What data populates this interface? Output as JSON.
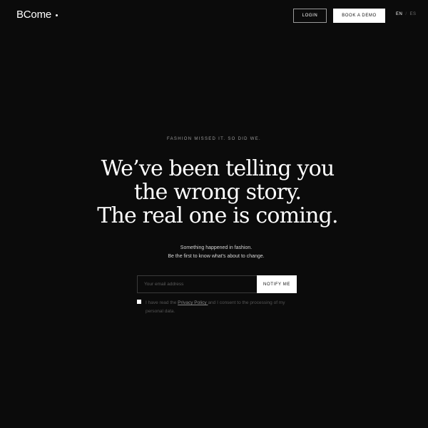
{
  "header": {
    "logo_text": "BCome",
    "login_label": "LOGIN",
    "demo_label": "BOOK A DEMO",
    "lang": {
      "active": "EN",
      "separator": "/",
      "inactive": "ES"
    }
  },
  "hero": {
    "eyebrow": "FASHION MISSED IT. SO DID WE.",
    "headline_lines": [
      "We’ve been telling you",
      "the wrong story.",
      "The real one is coming."
    ],
    "subtext_lines": [
      "Something happened in fashion.",
      "Be the first to know what’s about to change."
    ]
  },
  "form": {
    "email_placeholder": "Your email address",
    "email_value": "",
    "submit_label": "NOTIFY ME",
    "consent_before": "I have read the ",
    "consent_link": "Privacy Policy ",
    "consent_after": "and I consent to the processing of my personal data."
  },
  "colors": {
    "background": "#0b0b0b",
    "text": "#ffffff",
    "muted": "#9a9a9a"
  }
}
